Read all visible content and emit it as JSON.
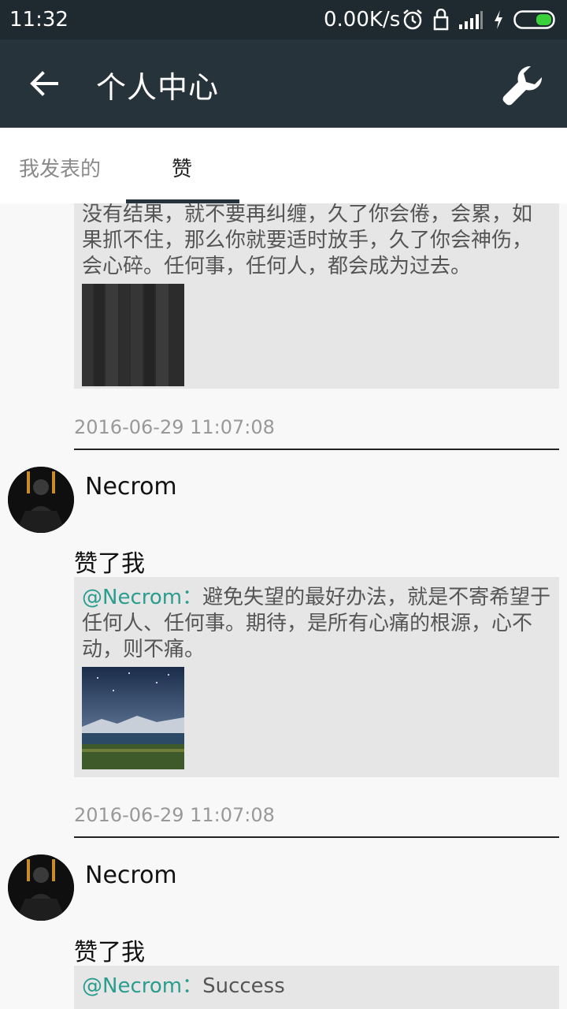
{
  "status_bar": {
    "time": "11:32",
    "network_speed": "0.00K/s",
    "icons": [
      "alarm-icon",
      "lock-icon",
      "signal-icon",
      "charging-icon",
      "battery-icon"
    ]
  },
  "app_bar": {
    "title": "个人中心",
    "back_icon": "back-arrow-icon",
    "settings_icon": "wrench-icon"
  },
  "tabs": [
    {
      "label": "我发表的",
      "active": false
    },
    {
      "label": "赞",
      "active": true
    }
  ],
  "feed": [
    {
      "quote_text": "没有结果，就不要再纠缠，久了你会倦，会累，如果抓不住，那么你就要适时放手，久了你会神伤，会心碎。任何事，任何人，都会成为过去。",
      "thumbnail": "dark-wood-image",
      "timestamp": "2016-06-29 11:07:08"
    },
    {
      "username": "Necrom",
      "action": "赞了我",
      "quote_author": "@Necrom：",
      "quote_text": "避免失望的最好办法，就是不寄希望于任何人、任何事。期待，是所有心痛的根源，心不动，则不痛。",
      "thumbnail": "night-lake-image",
      "timestamp": "2016-06-29 11:07:08"
    },
    {
      "username": "Necrom",
      "action": "赞了我",
      "quote_author": "@Necrom：",
      "quote_text": "Success"
    }
  ],
  "colors": {
    "status_bar": "#1f2a30",
    "app_bar": "#27333a",
    "mention": "#2a9d8f",
    "quote_bg": "#e6e6e6"
  }
}
